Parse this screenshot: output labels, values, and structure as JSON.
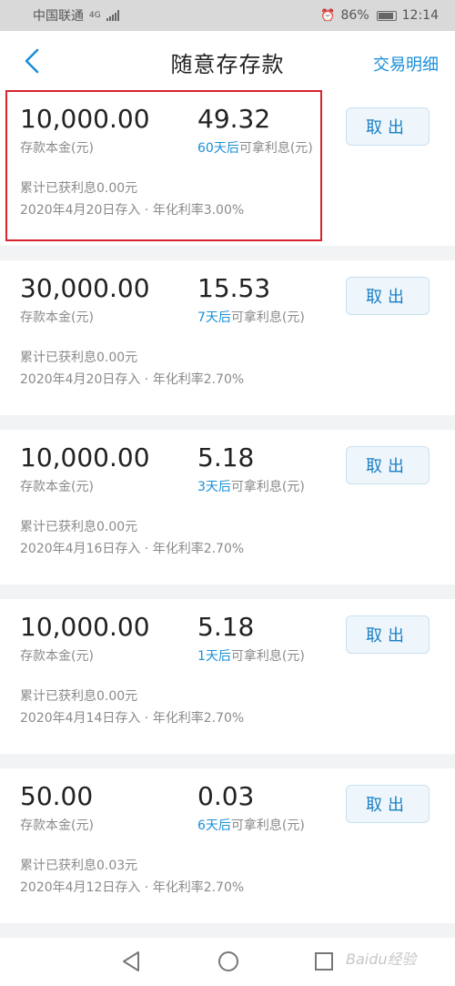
{
  "status_bar": {
    "carrier": "中国联通",
    "network": "4G",
    "battery": "86%",
    "time": "12:14"
  },
  "header": {
    "title": "随意存存款",
    "detail_link": "交易明细"
  },
  "labels": {
    "principal_label": "存款本金(元)",
    "interest_suffix": "可拿利息(元)",
    "withdraw_button": "取出"
  },
  "deposits": [
    {
      "amount": "10,000.00",
      "interest": "49.32",
      "days": "60天后",
      "accumulated": "累计已获利息0.00元",
      "meta": "2020年4月20日存入 · 年化利率3.00%"
    },
    {
      "amount": "30,000.00",
      "interest": "15.53",
      "days": "7天后",
      "accumulated": "累计已获利息0.00元",
      "meta": "2020年4月20日存入 · 年化利率2.70%"
    },
    {
      "amount": "10,000.00",
      "interest": "5.18",
      "days": "3天后",
      "accumulated": "累计已获利息0.00元",
      "meta": "2020年4月16日存入 · 年化利率2.70%"
    },
    {
      "amount": "10,000.00",
      "interest": "5.18",
      "days": "1天后",
      "accumulated": "累计已获利息0.00元",
      "meta": "2020年4月14日存入 · 年化利率2.70%"
    },
    {
      "amount": "50.00",
      "interest": "0.03",
      "days": "6天后",
      "accumulated": "累计已获利息0.03元",
      "meta": "2020年4月12日存入 · 年化利率2.70%"
    }
  ],
  "watermark": "Baidu经验",
  "colors": {
    "accent": "#1a8fd8",
    "highlight": "#d9232e",
    "background": "#f2f3f5"
  }
}
